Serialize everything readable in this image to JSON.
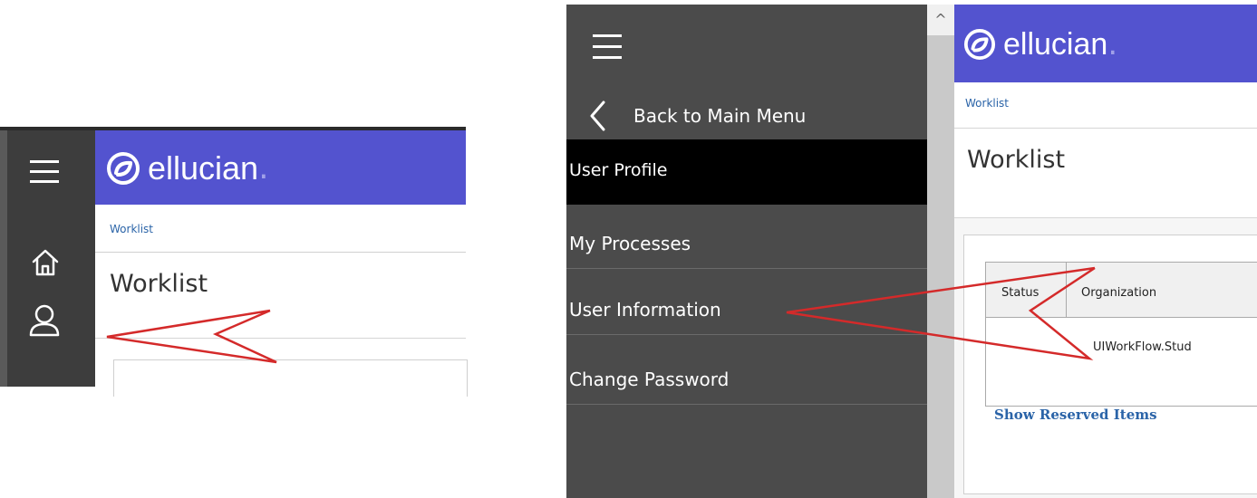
{
  "brand": {
    "logo_text": "ellucian",
    "logo_dot": ".",
    "header_color": "#5353cf",
    "sidebar_color": "#4b4b4b",
    "active_item_color": "#000000",
    "link_color": "#2b64a8",
    "annotation_color": "#d42a2a"
  },
  "left_view": {
    "breadcrumb": "Worklist",
    "page_title": "Worklist",
    "rail_icons": [
      "hamburger-menu-icon",
      "home-icon",
      "user-profile-icon"
    ]
  },
  "right_view": {
    "menu_icon": "hamburger-menu-icon",
    "back_label": "Back to Main Menu",
    "section_label": "User Profile",
    "menu_items": [
      {
        "label": "My Processes"
      },
      {
        "label": "User Information"
      },
      {
        "label": "Change Password"
      }
    ],
    "scroll_up_glyph": "^",
    "breadcrumb": "Worklist",
    "page_title": "Worklist",
    "table": {
      "columns": [
        "Status",
        "Organization"
      ],
      "rows": [
        [
          "",
          "UIWorkFlow.Stud"
        ]
      ]
    },
    "show_reserved_link": "Show Reserved Items"
  }
}
